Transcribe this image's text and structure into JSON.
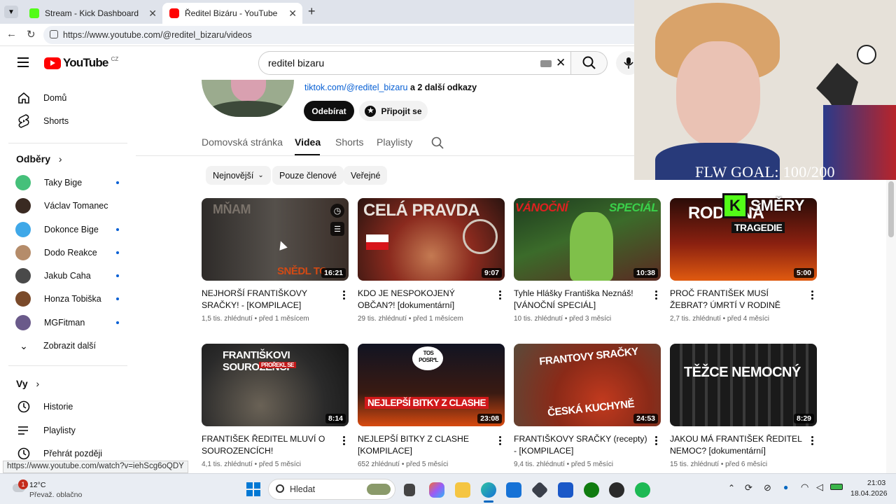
{
  "browser": {
    "tabs": [
      {
        "title": "Stream - Kick Dashboard",
        "active": false
      },
      {
        "title": "Ředitel Bizáru - YouTube",
        "active": true
      }
    ],
    "new_tab_symbol": "+",
    "url": "https://www.youtube.com/@reditel_bizaru/videos"
  },
  "youtube": {
    "logo_text": "YouTube",
    "region": "CZ",
    "search_value": "reditel bizaru"
  },
  "sidebar": {
    "primary": [
      {
        "label": "Domů",
        "icon": "home-icon"
      },
      {
        "label": "Shorts",
        "icon": "shorts-icon"
      }
    ],
    "subscriptions_title": "Odběry",
    "subscriptions": [
      {
        "label": "Taky Bige",
        "new": true,
        "color": "#45c07a"
      },
      {
        "label": "Václav Tomanec",
        "new": false,
        "color": "#3a2a22"
      },
      {
        "label": "Dokonce Bige",
        "new": true,
        "color": "#3fa8e8"
      },
      {
        "label": "Dodo Reakce",
        "new": true,
        "color": "#b58c6a"
      },
      {
        "label": "Jakub Caha",
        "new": true,
        "color": "#4a4a4a"
      },
      {
        "label": "Honza Tobiška",
        "new": true,
        "color": "#7a4a2a"
      },
      {
        "label": "MGFitman",
        "new": true,
        "color": "#6a5a8a"
      }
    ],
    "show_more": "Zobrazit další",
    "you_title": "Vy",
    "you_items": [
      {
        "label": "Historie",
        "icon": "history-icon"
      },
      {
        "label": "Playlisty",
        "icon": "playlists-icon"
      },
      {
        "label": "Přehrát později",
        "icon": "watch-later-icon"
      }
    ]
  },
  "channel": {
    "link": "tiktok.com/@reditel_bizaru",
    "link_suffix": "a 2 další odkazy",
    "subscribe_label": "Odebírat",
    "join_label": "Připojit se",
    "tabs": [
      "Domovská stránka",
      "Videa",
      "Shorts",
      "Playlisty"
    ],
    "active_tab": "Videa",
    "chips": [
      "Nejnovější",
      "Pouze členové",
      "Veřejné"
    ]
  },
  "videos": [
    {
      "title": "NEJHORŠÍ FRANTIŠKOVY SRAČKY! - [KOMPILACE]",
      "views": "1,5 tis. zhlédnutí",
      "age": "před 1 měsícem",
      "duration": "16:21",
      "thumb_text": "MŇAM",
      "thumb_text2": "SNĚDL TO",
      "bg": "#3a3633"
    },
    {
      "title": "KDO JE NESPOKOJENÝ OBČAN?! [dokumentární]",
      "views": "29 tis. zhlédnutí",
      "age": "před 1 měsícem",
      "duration": "9:07",
      "thumb_text": "CELÁ PRAVDA",
      "thumb_text2": "",
      "bg": "#8a2a1e"
    },
    {
      "title": "Tyhle Hlášky Františka Neznáš! [VÁNOČNÍ SPECIÁL]",
      "views": "10 tis. zhlédnutí",
      "age": "před 3 měsíci",
      "duration": "10:38",
      "thumb_text": "VÁNOČNÍ",
      "thumb_text2": "SPECIÁL",
      "bg": "#2d4a2a"
    },
    {
      "title": "PROČ FRANTIŠEK MUSÍ ŽEBRAT? ÚMRTÍ V RODINĚ",
      "views": "2,7 tis. zhlédnutí",
      "age": "před 4 měsíci",
      "duration": "5:00",
      "thumb_text": "RODINNÁ",
      "thumb_text2": "TRAGEDIE",
      "bg": "#4a1a10"
    },
    {
      "title": "FRANTIŠEK ŘEDITEL MLUVÍ O SOUROZENCÍCH!",
      "views": "4,1 tis. zhlédnutí",
      "age": "před 5 měsíci",
      "duration": "8:14",
      "thumb_text": "FRANTIŠKOVI SOUROZENCI",
      "thumb_text2": "PROŘEKL SE",
      "bg": "#2a2a2a"
    },
    {
      "title": "NEJLEPŠÍ BITKY Z CLASHE [KOMPILACE]",
      "views": "652 zhlédnutí",
      "age": "před 5 měsíci",
      "duration": "23:08",
      "thumb_text": "NEJLEPŠÍ BITKY Z CLASHE",
      "thumb_text2": "TOS POSR*L",
      "bg": "#1a1a2a"
    },
    {
      "title": "FRANTIŠKOVY SRAČKY (recepty) - [KOMPILACE]",
      "views": "9,4 tis. zhlédnutí",
      "age": "před 5 měsíci",
      "duration": "24:53",
      "thumb_text": "FRANTOVY SRAČKY",
      "thumb_text2": "ČESKÁ KUCHYNĚ",
      "bg": "#a23a22"
    },
    {
      "title": "JAKOU MÁ FRANTIŠEK ŘEDITEL NEMOC? [dokumentární]",
      "views": "15 tis. zhlédnutí",
      "age": "před 6 měsíci",
      "duration": "8:29",
      "thumb_text": "TĚŽCE NEMOCNÝ",
      "thumb_text2": "",
      "bg": "#1e1e1e"
    }
  ],
  "meta_separator": "•",
  "stream_overlay": {
    "goal_text": "FLW GOAL: 100/200",
    "badge_text": "SMĚRY"
  },
  "status_link": "https://www.youtube.com/watch?v=iehScg6oQDY",
  "taskbar": {
    "weather_temp": "12°C",
    "weather_desc": "Převaž. oblačno",
    "weather_badge": "1",
    "search_placeholder": "Hledat",
    "time": "21:03",
    "date": "18.04.2026"
  }
}
